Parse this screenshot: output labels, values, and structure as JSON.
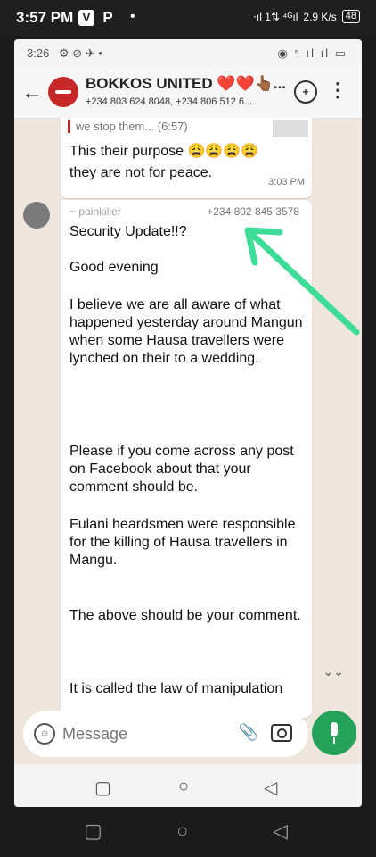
{
  "outer_status": {
    "time": "3:57 PM",
    "app_icons": [
      "V",
      "P"
    ],
    "dot": "•",
    "signal": "⋅ıl 1⇅ ⁴ᴳıl",
    "speed": "2.9 K/s",
    "battery": "48"
  },
  "inner_status": {
    "time": "3:26",
    "icons": "⚙ ⊘ ✈ •",
    "right": "◉ ⁵ ıl ıl ▭"
  },
  "header": {
    "back": "←",
    "group_name": "BOKKOS UNITED ❤️❤️👆🏾...",
    "members": "+234 803 624 8048, +234 806 512 6...",
    "call_label": "+",
    "menu": "⋮"
  },
  "prev_message": {
    "quote": "we stop them... (6:57)",
    "text_line1": "This their purpose 😩😩😩😩",
    "text_line2": "they are not for peace.",
    "time": "3:03 PM"
  },
  "message": {
    "sender": "~ painkiller",
    "phone": "+234 802 845 3578",
    "lines": [
      "Security Update!!?",
      "Good evening",
      "I believe we are all aware of what happened yesterday around Mangun when some Hausa travellers were lynched on their to a wedding.",
      "Please if you come across any post on Facebook about that your comment should be.",
      "Fulani heardsmen were responsible for the killing of Hausa travellers in Mangu.",
      "The above should be your comment.",
      "It is called the law of manipulation"
    ]
  },
  "composer": {
    "placeholder": "Message",
    "emoji": "☺",
    "attach": "📎"
  },
  "scroll_down": "⌄⌄",
  "nav": {
    "square": "▢",
    "circle": "○",
    "back": "◁"
  },
  "colors": {
    "accent_green": "#25a35a",
    "arrow": "#3ddc97",
    "avatar_red": "#c62828"
  }
}
